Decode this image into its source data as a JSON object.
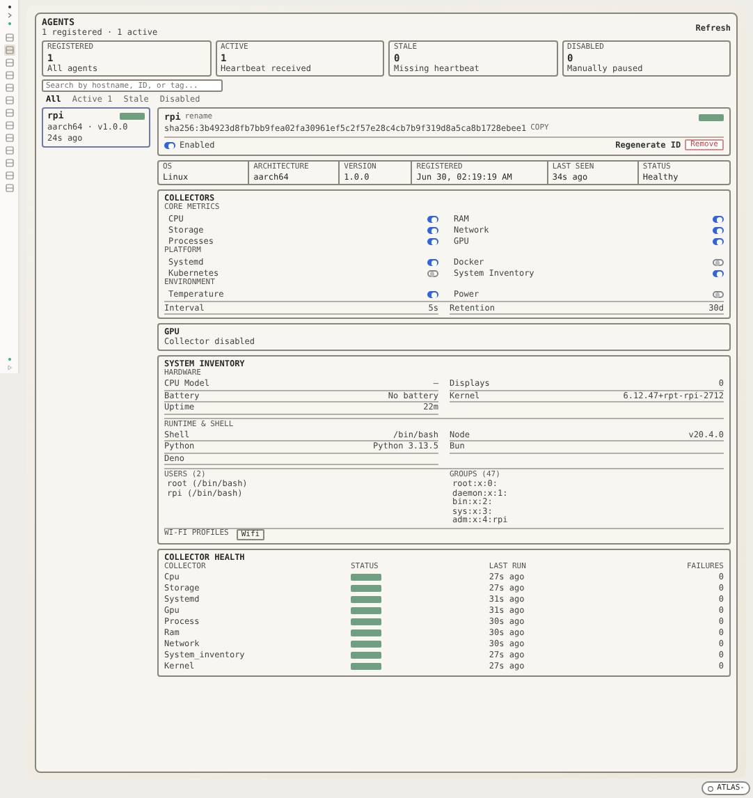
{
  "sidebar": {
    "items": [
      {
        "selected": false
      },
      {
        "selected": true
      },
      {
        "selected": false
      },
      {
        "selected": false
      },
      {
        "selected": false
      },
      {
        "selected": false
      },
      {
        "selected": false
      },
      {
        "selected": false
      },
      {
        "selected": false
      },
      {
        "selected": false
      },
      {
        "selected": false
      },
      {
        "selected": false
      },
      {
        "selected": false
      }
    ]
  },
  "page": {
    "title": "AGENTS",
    "subtitle": "1 registered · 1 active",
    "refresh": "Refresh"
  },
  "stats": [
    {
      "label": "REGISTERED",
      "value": "1",
      "note": "All agents"
    },
    {
      "label": "ACTIVE",
      "value": "1",
      "note": "Heartbeat received"
    },
    {
      "label": "STALE",
      "value": "0",
      "note": "Missing heartbeat"
    },
    {
      "label": "DISABLED",
      "value": "0",
      "note": "Manually paused"
    }
  ],
  "search": {
    "placeholder": "Search by hostname, ID, or tag..."
  },
  "filters": [
    {
      "label": "All",
      "selected": true
    },
    {
      "label": "Active 1",
      "selected": false
    },
    {
      "label": "Stale",
      "selected": false
    },
    {
      "label": "Disabled",
      "selected": false
    }
  ],
  "agents": [
    {
      "name": "rpi",
      "online": true,
      "meta": "aarch64 · v1.0.0",
      "seen": "24s ago",
      "selected": true
    }
  ],
  "detail": {
    "name": "rpi",
    "rename": "rename",
    "online": true,
    "hash": "sha256:3b4923d8fb7bb9fea02fa30961ef5c2f57e28c4cb7b9f319d8a5ca8b1728ebee1",
    "copy": "COPY",
    "enabled": true,
    "enabled_label": "Enabled",
    "regenerate": "Regenerate ID",
    "remove": "Remove"
  },
  "info": [
    {
      "label": "OS",
      "value": "Linux"
    },
    {
      "label": "ARCHITECTURE",
      "value": "aarch64"
    },
    {
      "label": "VERSION",
      "value": "1.0.0"
    },
    {
      "label": "REGISTERED",
      "value": "Jun 30, 02:19:19 AM"
    },
    {
      "label": "LAST SEEN",
      "value": "34s ago"
    },
    {
      "label": "STATUS",
      "value": "Healthy"
    }
  ],
  "collectors": {
    "title": "COLLECTORS",
    "groups": [
      {
        "title": "CORE METRICS",
        "items": [
          {
            "label": "CPU",
            "on": true
          },
          {
            "label": "RAM",
            "on": true
          },
          {
            "label": "Storage",
            "on": true
          },
          {
            "label": "Network",
            "on": true
          },
          {
            "label": "Processes",
            "on": true
          },
          {
            "label": "GPU",
            "on": true
          }
        ]
      },
      {
        "title": "PLATFORM",
        "items": [
          {
            "label": "Systemd",
            "on": true
          },
          {
            "label": "Docker",
            "on": false
          },
          {
            "label": "Kubernetes",
            "on": false
          },
          {
            "label": "System Inventory",
            "on": true
          }
        ]
      },
      {
        "title": "ENVIRONMENT",
        "items": [
          {
            "label": "Temperature",
            "on": true
          },
          {
            "label": "Power",
            "on": false
          }
        ]
      }
    ],
    "settings": [
      {
        "label": "Interval",
        "value": "5s"
      },
      {
        "label": "Retention",
        "value": "30d"
      }
    ]
  },
  "gpu": {
    "title": "GPU",
    "note": "Collector disabled"
  },
  "inventory": {
    "title": "SYSTEM INVENTORY",
    "sections": [
      {
        "title": "HARDWARE",
        "rows": [
          {
            "label": "CPU Model",
            "value": "—"
          },
          {
            "label": "Displays",
            "value": "0"
          },
          {
            "label": "Battery",
            "value": "No battery"
          },
          {
            "label": "Kernel",
            "value": "6.12.47+rpt-rpi-2712"
          },
          {
            "label": "Uptime",
            "value": "22m"
          }
        ]
      },
      {
        "title": "RUNTIME & SHELL",
        "rows": [
          {
            "label": "Shell",
            "value": "/bin/bash"
          },
          {
            "label": "Node",
            "value": "v20.4.0"
          },
          {
            "label": "Python",
            "value": "Python 3.13.5"
          },
          {
            "label": "Bun"
          },
          {
            "label": "Deno"
          }
        ]
      }
    ],
    "users": {
      "title": "USERS (2)",
      "items": [
        "root (/bin/bash)",
        "rpi (/bin/bash)"
      ]
    },
    "groups": {
      "title": "GROUPS (47)",
      "items": [
        "root:x:0:",
        "daemon:x:1:",
        "bin:x:2:",
        "sys:x:3:",
        "adm:x:4:rpi"
      ]
    },
    "wifi": {
      "title": "WI-FI PROFILES",
      "items": [
        "Wifi"
      ]
    }
  },
  "health": {
    "title": "COLLECTOR HEALTH",
    "columns": [
      "COLLECTOR",
      "STATUS",
      "LAST RUN",
      "FAILURES"
    ],
    "rows": [
      {
        "collector": "Cpu",
        "healthy": true,
        "last_run": "27s ago",
        "failures": "0"
      },
      {
        "collector": "Storage",
        "healthy": true,
        "last_run": "27s ago",
        "failures": "0"
      },
      {
        "collector": "Systemd",
        "healthy": true,
        "last_run": "31s ago",
        "failures": "0"
      },
      {
        "collector": "Gpu",
        "healthy": true,
        "last_run": "31s ago",
        "failures": "0"
      },
      {
        "collector": "Process",
        "healthy": true,
        "last_run": "30s ago",
        "failures": "0"
      },
      {
        "collector": "Ram",
        "healthy": true,
        "last_run": "30s ago",
        "failures": "0"
      },
      {
        "collector": "Network",
        "healthy": true,
        "last_run": "30s ago",
        "failures": "0"
      },
      {
        "collector": "System_inventory",
        "healthy": true,
        "last_run": "27s ago",
        "failures": "0"
      },
      {
        "collector": "Kernel",
        "healthy": true,
        "last_run": "27s ago",
        "failures": "0"
      }
    ]
  },
  "footer": {
    "label": "ATLAS-"
  }
}
